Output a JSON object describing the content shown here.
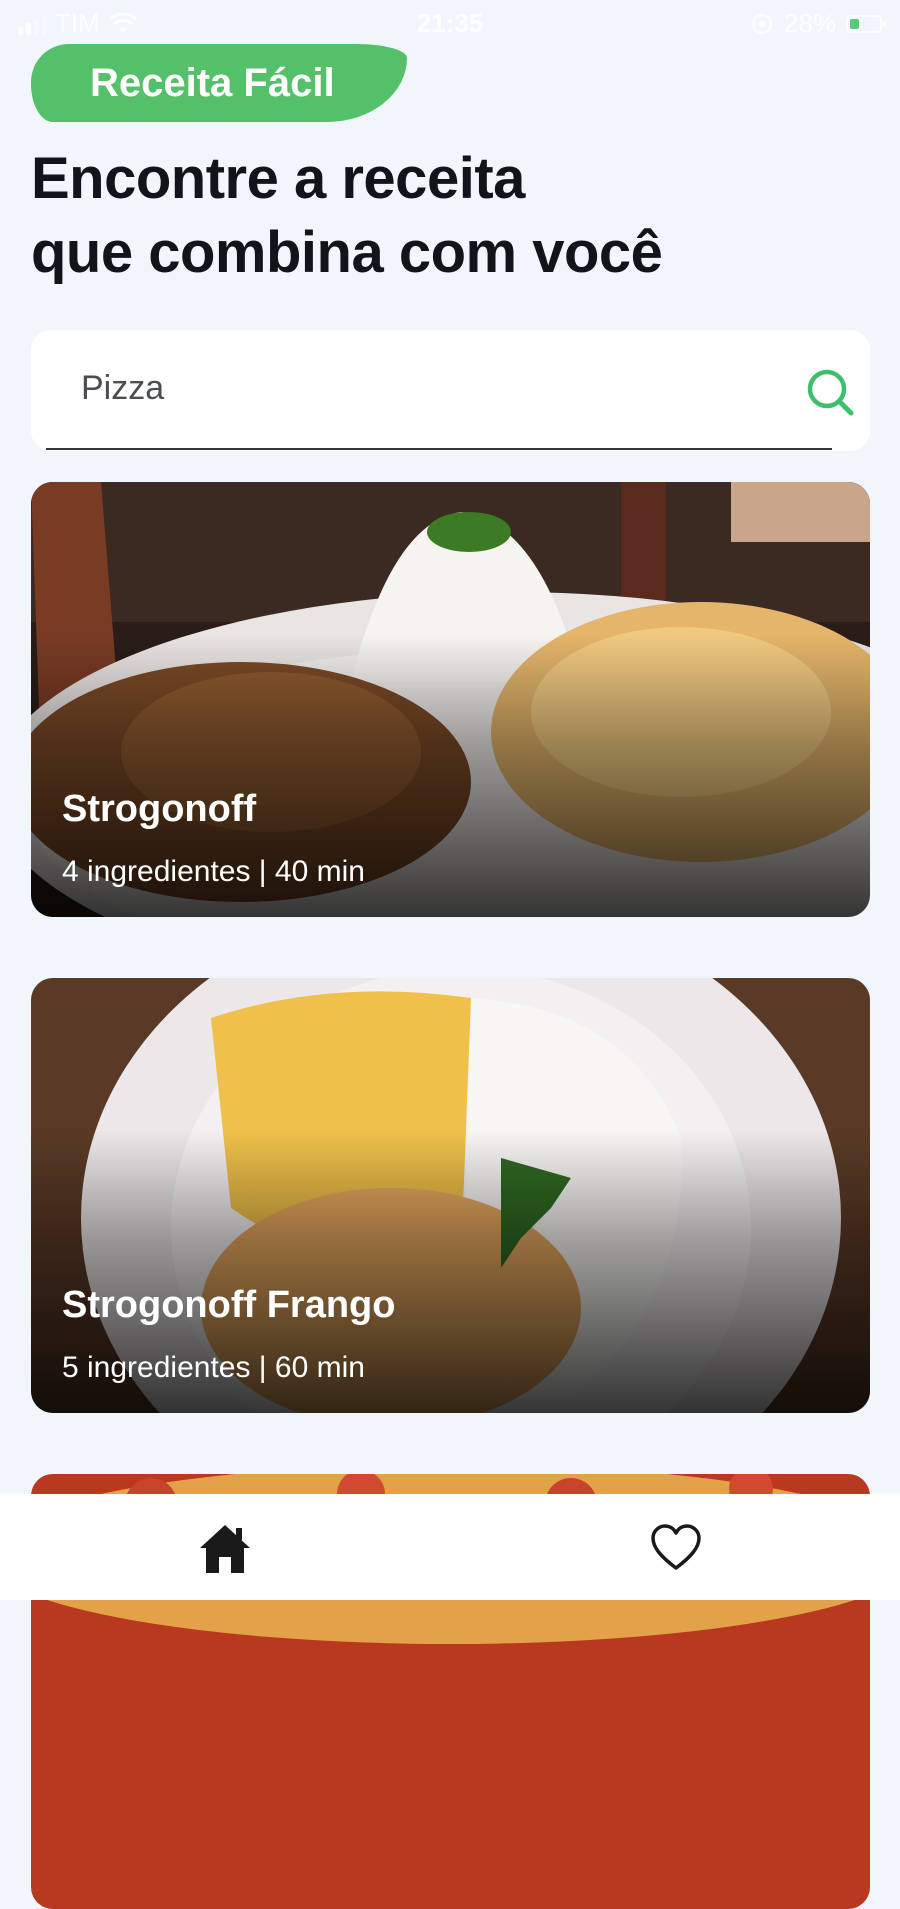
{
  "status_bar": {
    "carrier": "TIM",
    "time": "21:35",
    "battery_percent": "28%",
    "signal_bars": 2,
    "icons": [
      "signal-icon",
      "wifi-icon",
      "lock-rotation-icon",
      "battery-icon"
    ]
  },
  "header": {
    "brand": "Receita Fácil",
    "headline_line1": "Encontre a receita",
    "headline_line2": "que combina com você"
  },
  "search": {
    "value": "Pizza",
    "icon": "search-icon"
  },
  "recipes": [
    {
      "title": "Strogonoff",
      "meta": "4 ingredientes | 40 min"
    },
    {
      "title": "Strogonoff Frango",
      "meta": "5 ingredientes | 60 min"
    },
    {
      "title": "",
      "meta": ""
    }
  ],
  "bottom_nav": {
    "items": [
      "home-icon",
      "heart-icon"
    ]
  },
  "colors": {
    "background": "#f1f6fc",
    "brand_green": "#55c06a",
    "search_icon": "#3fbf6b",
    "text_dark": "#111418"
  }
}
